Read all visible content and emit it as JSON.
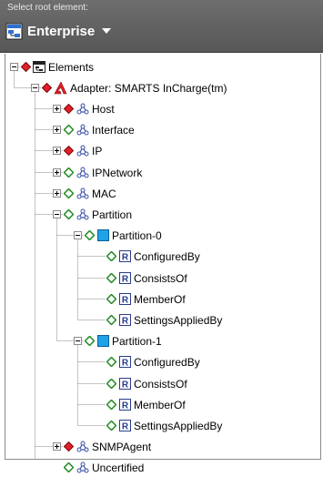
{
  "header": {
    "label": "Select root element:",
    "root_name": "Enterprise",
    "bg_color": "#636363"
  },
  "tree": {
    "elements_label": "Elements",
    "adapter_label": "Adapter: SMARTS InCharge(tm)",
    "classes": [
      {
        "label": "Host",
        "status": "red",
        "expandable": true,
        "expanded": false
      },
      {
        "label": "Interface",
        "status": "green",
        "expandable": true,
        "expanded": false
      },
      {
        "label": "IP",
        "status": "red",
        "expandable": true,
        "expanded": false
      },
      {
        "label": "IPNetwork",
        "status": "green",
        "expandable": true,
        "expanded": false
      },
      {
        "label": "MAC",
        "status": "green",
        "expandable": true,
        "expanded": false
      },
      {
        "label": "Partition",
        "status": "green",
        "expandable": true,
        "expanded": true
      },
      {
        "label": "SNMPAgent",
        "status": "red",
        "expandable": true,
        "expanded": false
      },
      {
        "label": "Uncertified",
        "status": "green",
        "expandable": false,
        "expanded": false
      }
    ],
    "partitions": [
      {
        "label": "Partition-0",
        "relations": [
          "ConfiguredBy",
          "ConsistsOf",
          "MemberOf",
          "SettingsAppliedBy"
        ]
      },
      {
        "label": "Partition-1",
        "relations": [
          "ConfiguredBy",
          "ConsistsOf",
          "MemberOf",
          "SettingsAppliedBy"
        ]
      }
    ],
    "colors": {
      "red": "#e0202a",
      "green": "#3cc43c",
      "instance": "#1fa3e8"
    }
  }
}
